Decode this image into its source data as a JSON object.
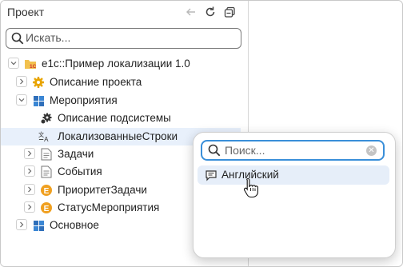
{
  "panel": {
    "title": "Проект",
    "search_placeholder": "Искать..."
  },
  "header_icons": [
    "back-arrow-icon",
    "refresh-icon",
    "collapse-all-icon"
  ],
  "tree": [
    {
      "label": "e1c::Пример локализации 1.0",
      "icon": "project-folder-icon",
      "expanded": true
    },
    {
      "label": "Описание проекта",
      "icon": "gear-icon",
      "expanded": false
    },
    {
      "label": "Мероприятия",
      "icon": "subsystem-icon",
      "expanded": true
    },
    {
      "label": "Описание подсистемы",
      "icon": "settings-gear-icon"
    },
    {
      "label": "ЛокализованныеСтроки",
      "icon": "localization-icon",
      "selected": true
    },
    {
      "label": "Задачи",
      "icon": "document-icon",
      "expanded": false
    },
    {
      "label": "События",
      "icon": "document-icon",
      "expanded": false
    },
    {
      "label": "ПриоритетЗадачи",
      "icon": "enum-icon",
      "expanded": false
    },
    {
      "label": "СтатусМероприятия",
      "icon": "enum-icon",
      "expanded": false
    },
    {
      "label": "Основное",
      "icon": "subsystem-icon",
      "expanded": false
    }
  ],
  "popup": {
    "search_placeholder": "Поиск...",
    "items": [
      {
        "label": "Английский",
        "icon": "language-icon"
      }
    ]
  },
  "colors": {
    "accent": "#3a8fd9",
    "selection": "#e8f0fb",
    "gear": "#e8a400",
    "enum": "#f0a020",
    "subsystem": "#2f6fba"
  }
}
